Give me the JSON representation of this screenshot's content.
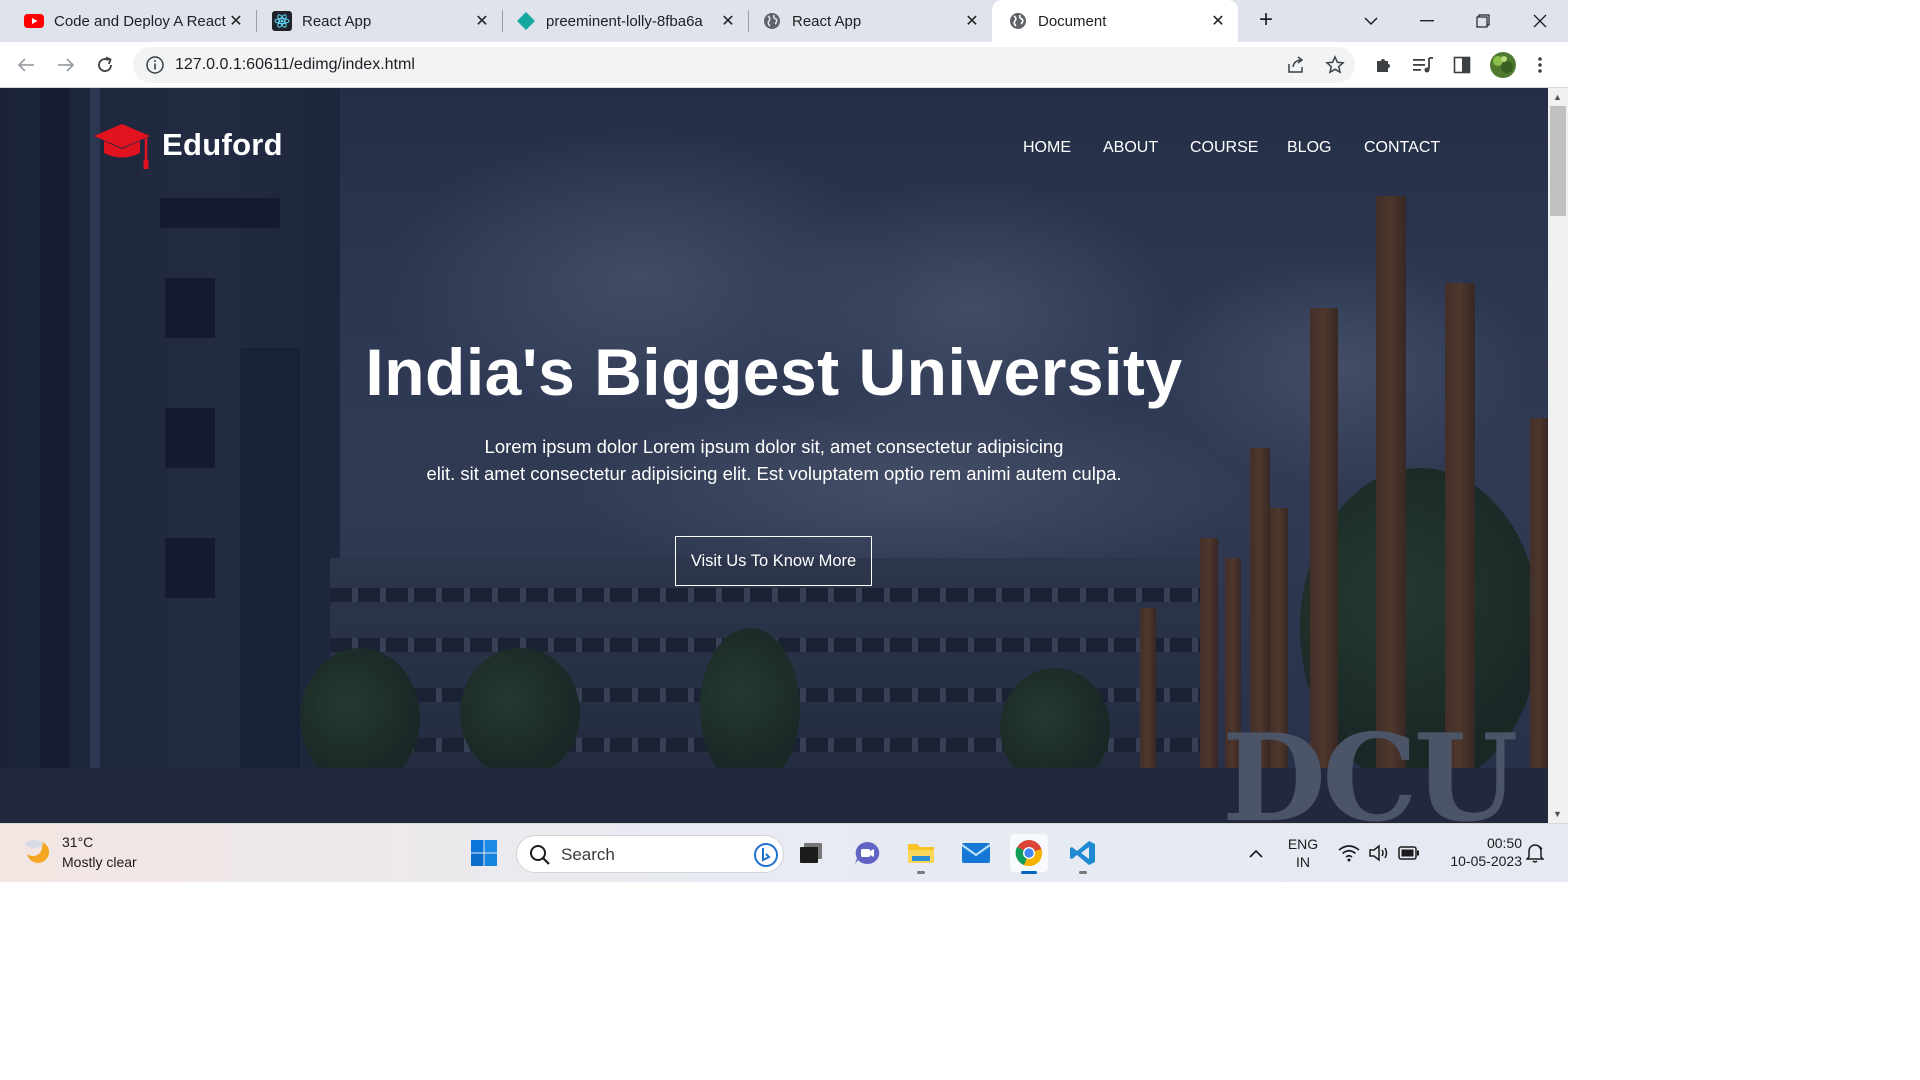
{
  "browser": {
    "tabs": [
      {
        "title": "Code and Deploy A React",
        "favicon": "youtube-icon"
      },
      {
        "title": "React App",
        "favicon": "react-icon"
      },
      {
        "title": "preeminent-lolly-8fba6a",
        "favicon": "netlify-icon"
      },
      {
        "title": "React App",
        "favicon": "globe-icon"
      },
      {
        "title": "Document",
        "favicon": "globe-icon"
      }
    ],
    "active_tab": 4,
    "url": "127.0.0.1:60611/edimg/index.html"
  },
  "site": {
    "brand": "Eduford",
    "nav": [
      "HOME",
      "ABOUT",
      "COURSE",
      "BLOG",
      "CONTACT"
    ],
    "hero_title": "India's Biggest University",
    "hero_line1": "Lorem ipsum dolor Lorem ipsum dolor sit, amet consectetur adipisicing",
    "hero_line2": "elit. sit amet consectetur adipisicing elit. Est voluptatem optio rem animi autem culpa.",
    "cta": "Visit Us To Know More",
    "sign_text": "DCU"
  },
  "taskbar": {
    "weather_temp": "31°C",
    "weather_desc": "Mostly clear",
    "search_label": "Search",
    "lang_line1": "ENG",
    "lang_line2": "IN",
    "time": "00:50",
    "date": "10-05-2023"
  },
  "colors": {
    "accent_red": "#e0131f",
    "chrome_tabstrip": "#dfe3eb",
    "windows_blue": "#0067c0"
  }
}
